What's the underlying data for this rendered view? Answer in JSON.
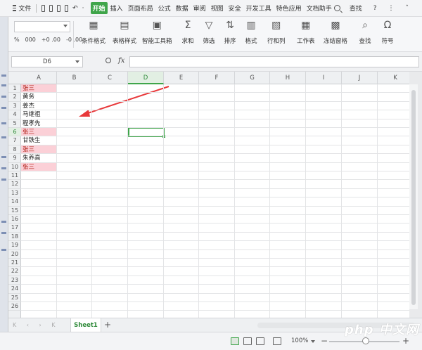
{
  "menu": {
    "file": "文件",
    "tabs": [
      "开始",
      "插入",
      "页面布局",
      "公式",
      "数据",
      "审阅",
      "视图",
      "安全",
      "开发工具",
      "特色应用",
      "文档助手"
    ],
    "active_tab": "开始",
    "search": "查找",
    "help": "?"
  },
  "ribbon": {
    "num_percent": "%",
    "num_thousands": "000",
    "num_inc": "+0 .00",
    "num_dec": "-0 .00",
    "buttons": [
      "条件格式",
      "表格样式",
      "智能工具箱",
      "求和",
      "筛选",
      "排序",
      "格式",
      "行和列",
      "工作表",
      "冻结窗格",
      "查找",
      "符号"
    ]
  },
  "formula_bar": {
    "name_box": "D6",
    "fx": "fx",
    "formula": ""
  },
  "grid": {
    "columns": [
      "A",
      "B",
      "C",
      "D",
      "E",
      "F",
      "G",
      "H",
      "I",
      "J",
      "K"
    ],
    "selected_column": "D",
    "rows": [
      "1",
      "2",
      "3",
      "4",
      "5",
      "6",
      "7",
      "8",
      "9",
      "10",
      "11",
      "12",
      "13",
      "14",
      "15",
      "16",
      "17",
      "18",
      "19",
      "20",
      "21",
      "22",
      "23",
      "24",
      "25",
      "26"
    ],
    "column_a": [
      "张三",
      "黄务",
      "姜杰",
      "马继祖",
      "程孝先",
      "张三",
      "甘铁生",
      "张三",
      "朱养高",
      "张三"
    ],
    "highlighted_rows": [
      1,
      6,
      8,
      10
    ]
  },
  "sheet_tabs": {
    "active": "Sheet1",
    "add": "+"
  },
  "status": {
    "zoom": "100%",
    "minus": "−",
    "plus": "+"
  },
  "watermark": "php 中文网",
  "colors": {
    "accent": "#3fa54a",
    "highlight_fill": "#fbd0d7",
    "highlight_text": "#b3261e",
    "arrow": "#e8383a"
  }
}
